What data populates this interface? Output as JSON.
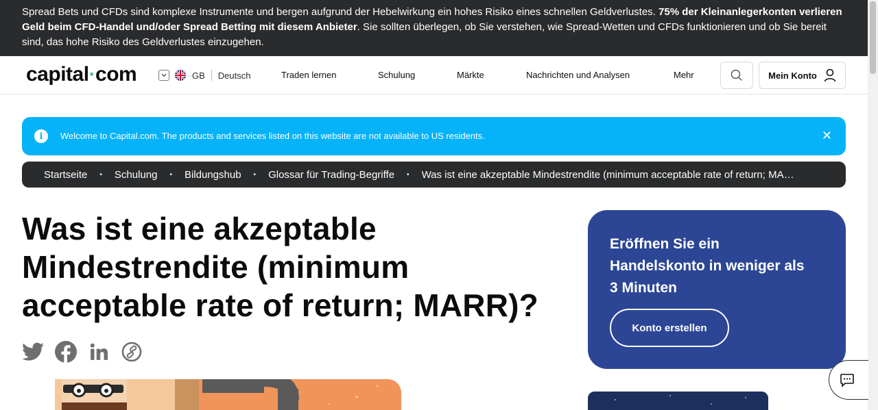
{
  "risk_banner": {
    "text_1": "Spread Bets und CFDs sind komplexe Instrumente und bergen aufgrund der Hebelwirkung ein hohes Risiko eines schnellen Geldverlustes. ",
    "text_bold": "75% der Kleinanlegerkonten verlieren Geld beim CFD-Handel und/oder Spread Betting mit diesem Anbieter",
    "text_2": ". Sie sollten überlegen, ob Sie verstehen, wie Spread-Wetten und CFDs funktionieren und ob Sie bereit sind, das hohe Risiko des Geldverlustes einzugehen."
  },
  "header": {
    "logo_text_1": "capital",
    "logo_dot": "·",
    "logo_text_2": "com",
    "region": "GB",
    "language": "Deutsch",
    "nav": {
      "learn": "Traden lernen",
      "education": "Schulung",
      "markets": "Märkte",
      "news": "Nachrichten und Analysen",
      "more": "Mehr"
    },
    "account_label": "Mein Konto"
  },
  "info_bar": {
    "icon": "info-icon",
    "message": "Welcome to Capital.com. The products and services listed on this website are not available to US residents.",
    "close": "✕"
  },
  "breadcrumb": {
    "items": [
      "Startseite",
      "Schulung",
      "Bildungshub",
      "Glossar für Trading-Begriffe",
      "Was ist eine akzeptable Mindestrendite (minimum acceptable rate of return; MARR)?"
    ],
    "separator": "•"
  },
  "article": {
    "title": "Was ist eine akzeptable Mindestrendite (minimum acceptable rate of return; MARR)?",
    "share_icons": [
      "twitter-icon",
      "facebook-icon",
      "linkedin-icon",
      "copy-link-icon"
    ]
  },
  "cta_card": {
    "title": "Eröffnen Sie ein Handelskonto in weniger als 3 Minuten",
    "button": "Konto erstellen"
  },
  "colors": {
    "banner_bg": "#2a2b2d",
    "info_bg": "#07b3f8",
    "cta_bg": "#2c4695",
    "logo_dot": "#4ac28a"
  }
}
